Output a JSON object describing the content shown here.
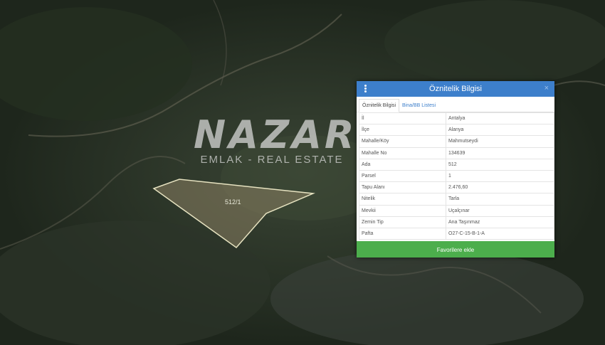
{
  "watermark": {
    "logo": "NAZAR",
    "tagline": "EMLAK - REAL ESTATE"
  },
  "map": {
    "parcel_label": "512/1"
  },
  "panel": {
    "title": "Öznitelik Bilgisi",
    "close_symbol": "×",
    "tabs": [
      {
        "label": "Öznitelik Bilgisi",
        "active": true
      },
      {
        "label": "Bina/BB Listesi",
        "active": false
      }
    ],
    "rows": [
      {
        "key": "İl",
        "value": "Antalya"
      },
      {
        "key": "İlçe",
        "value": "Alanya"
      },
      {
        "key": "Mahalle/Köy",
        "value": "Mahmutseydi"
      },
      {
        "key": "Mahalle No",
        "value": "134639"
      },
      {
        "key": "Ada",
        "value": "512"
      },
      {
        "key": "Parsel",
        "value": "1"
      },
      {
        "key": "Tapu Alanı",
        "value": "2.476,60"
      },
      {
        "key": "Nitelik",
        "value": "Tarla"
      },
      {
        "key": "Mevkii",
        "value": "Uçalçınar"
      },
      {
        "key": "Zemin Tip",
        "value": "Ana Taşınmaz"
      },
      {
        "key": "Pafta",
        "value": "O27-C-15-B-1-A"
      }
    ],
    "favorite_button": "Favorilere ekle"
  },
  "colors": {
    "header": "#3d7fcb",
    "button": "#4cae4c",
    "parcel_outline": "#e6e2c0"
  },
  "icons": {
    "menu": "vertical-dots-icon",
    "close": "close-icon"
  }
}
